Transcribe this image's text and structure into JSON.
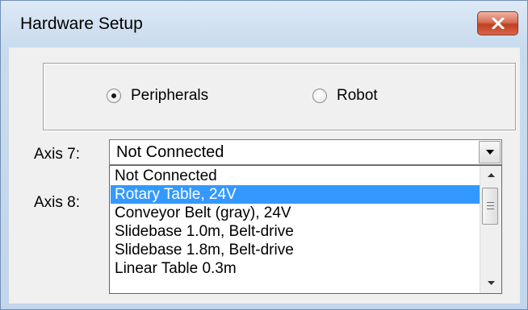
{
  "window": {
    "title": "Hardware Setup",
    "close_icon": "close-x-icon"
  },
  "mode_group": {
    "options": [
      {
        "label": "Peripherals",
        "checked": true
      },
      {
        "label": "Robot",
        "checked": false
      }
    ]
  },
  "axis7": {
    "label": "Axis 7:",
    "selected_value": "Not Connected"
  },
  "axis8": {
    "label": "Axis 8:"
  },
  "dropdown": {
    "items": [
      {
        "label": "Not Connected",
        "highlighted": false
      },
      {
        "label": "Rotary Table, 24V",
        "highlighted": true
      },
      {
        "label": "Conveyor Belt (gray),  24V",
        "highlighted": false
      },
      {
        "label": "Slidebase 1.0m, Belt-drive",
        "highlighted": false
      },
      {
        "label": "Slidebase 1.8m, Belt-drive",
        "highlighted": false
      },
      {
        "label": "Linear Table 0.3m",
        "highlighted": false
      }
    ]
  },
  "colors": {
    "selection": "#3399ff",
    "close_button": "#c7452a",
    "title_bar": "#c9dbee"
  }
}
